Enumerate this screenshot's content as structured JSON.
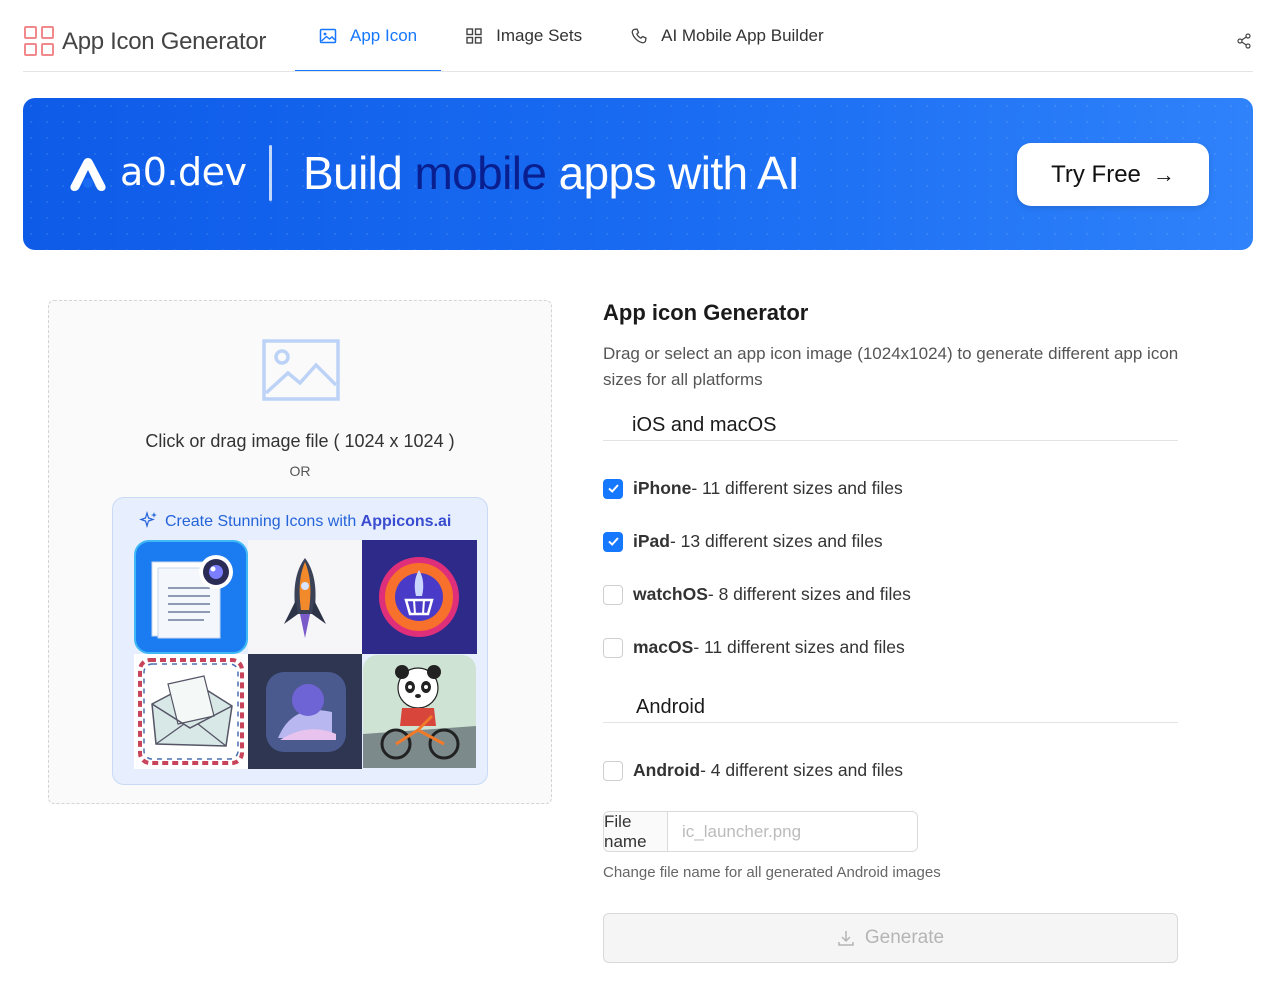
{
  "header": {
    "logo_text": "App Icon Generator",
    "tabs": [
      {
        "label": "App Icon",
        "icon": "image-icon",
        "active": true
      },
      {
        "label": "Image Sets",
        "icon": "grid-icon",
        "active": false
      },
      {
        "label": "AI Mobile App Builder",
        "icon": "phone-icon",
        "active": false
      }
    ],
    "accent_color": "#1677ff"
  },
  "banner": {
    "brand": "a0.dev",
    "title_pre": "Build ",
    "title_highlight": "mobile",
    "title_post": " apps with AI",
    "cta_label": "Try Free",
    "cta_arrow": "→"
  },
  "upload": {
    "prompt": "Click or drag image file ( 1024 x 1024 )",
    "or_text": "OR",
    "promo_text": "Create Stunning Icons with ",
    "promo_brand": "Appicons.ai",
    "promo_icon": "sparkles-icon"
  },
  "panel": {
    "title": "App icon Generator",
    "description": "Drag or select an app icon image (1024x1024) to generate different app icon sizes for all platforms",
    "section_ios": "iOS and macOS",
    "section_android": "Android",
    "options": [
      {
        "name": "iPhone",
        "detail": " - 11 different sizes and files",
        "checked": true
      },
      {
        "name": "iPad",
        "detail": " - 13 different sizes and files",
        "checked": true
      },
      {
        "name": "watchOS",
        "detail": " - 8 different sizes and files",
        "checked": false
      },
      {
        "name": "macOS",
        "detail": " - 11 different sizes and files",
        "checked": false
      },
      {
        "name": "Android",
        "detail": " - 4 different sizes and files",
        "checked": false
      }
    ],
    "file_name_label": "File name",
    "file_name_placeholder": "ic_launcher.png",
    "file_name_value": "",
    "file_name_hint": "Change file name for all generated Android images",
    "generate_label": "Generate"
  }
}
